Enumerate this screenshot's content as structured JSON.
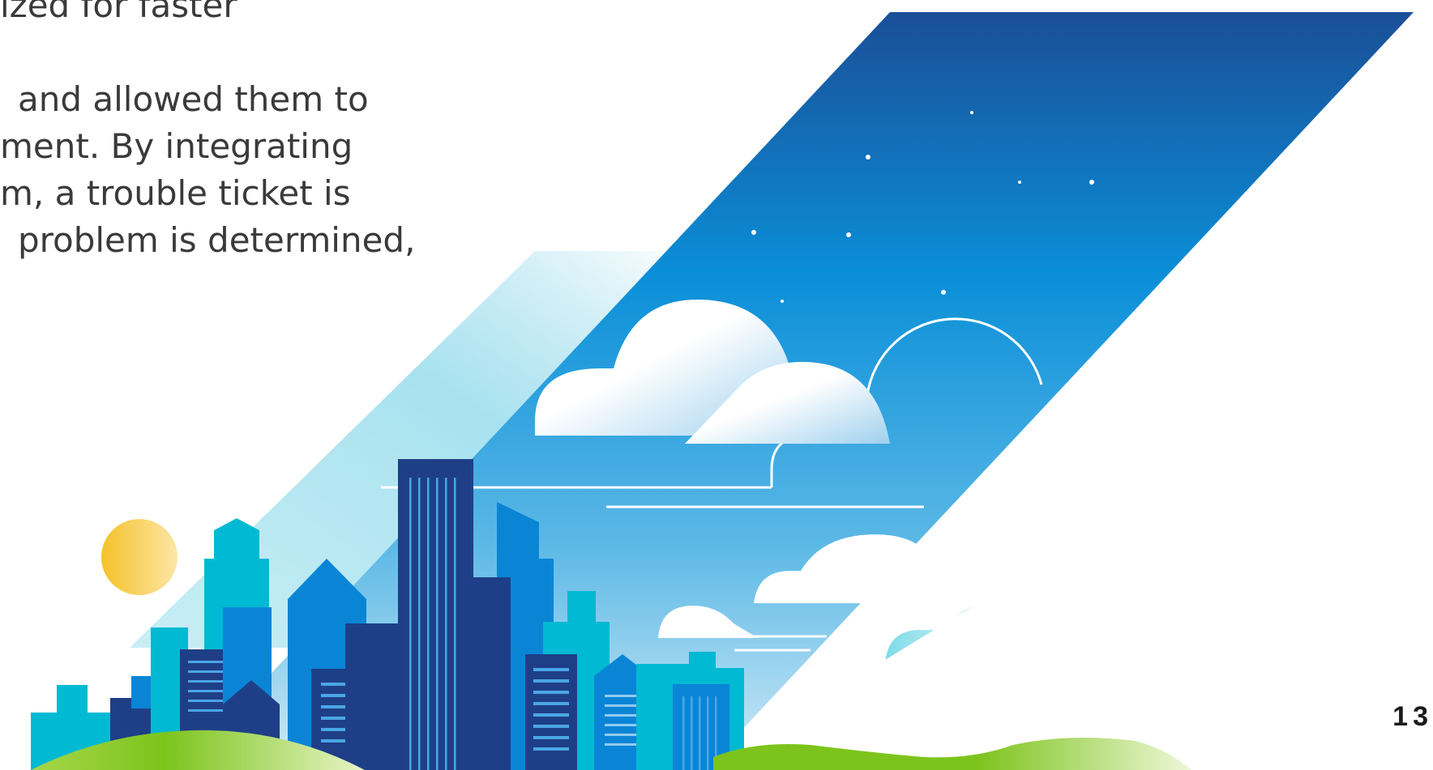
{
  "document": {
    "paragraph_fragments": [
      "ized for faster",
      "",
      "and allowed them to",
      "ment. By integrating",
      "m, a trouble ticket is",
      "problem is determined,"
    ],
    "page_number": "13"
  },
  "illustration": {
    "subject": "city skyline under night-to-day sky",
    "colors": {
      "sky_top": "#1a4f97",
      "sky_mid": "#0a8fd8",
      "sky_low": "#b9e2f2",
      "sun": "#f4c22a",
      "grass": "#7cc41c",
      "building_dark": "#1e3f87",
      "building_mid": "#0a85d6",
      "building_teal": "#00b9d2"
    }
  }
}
